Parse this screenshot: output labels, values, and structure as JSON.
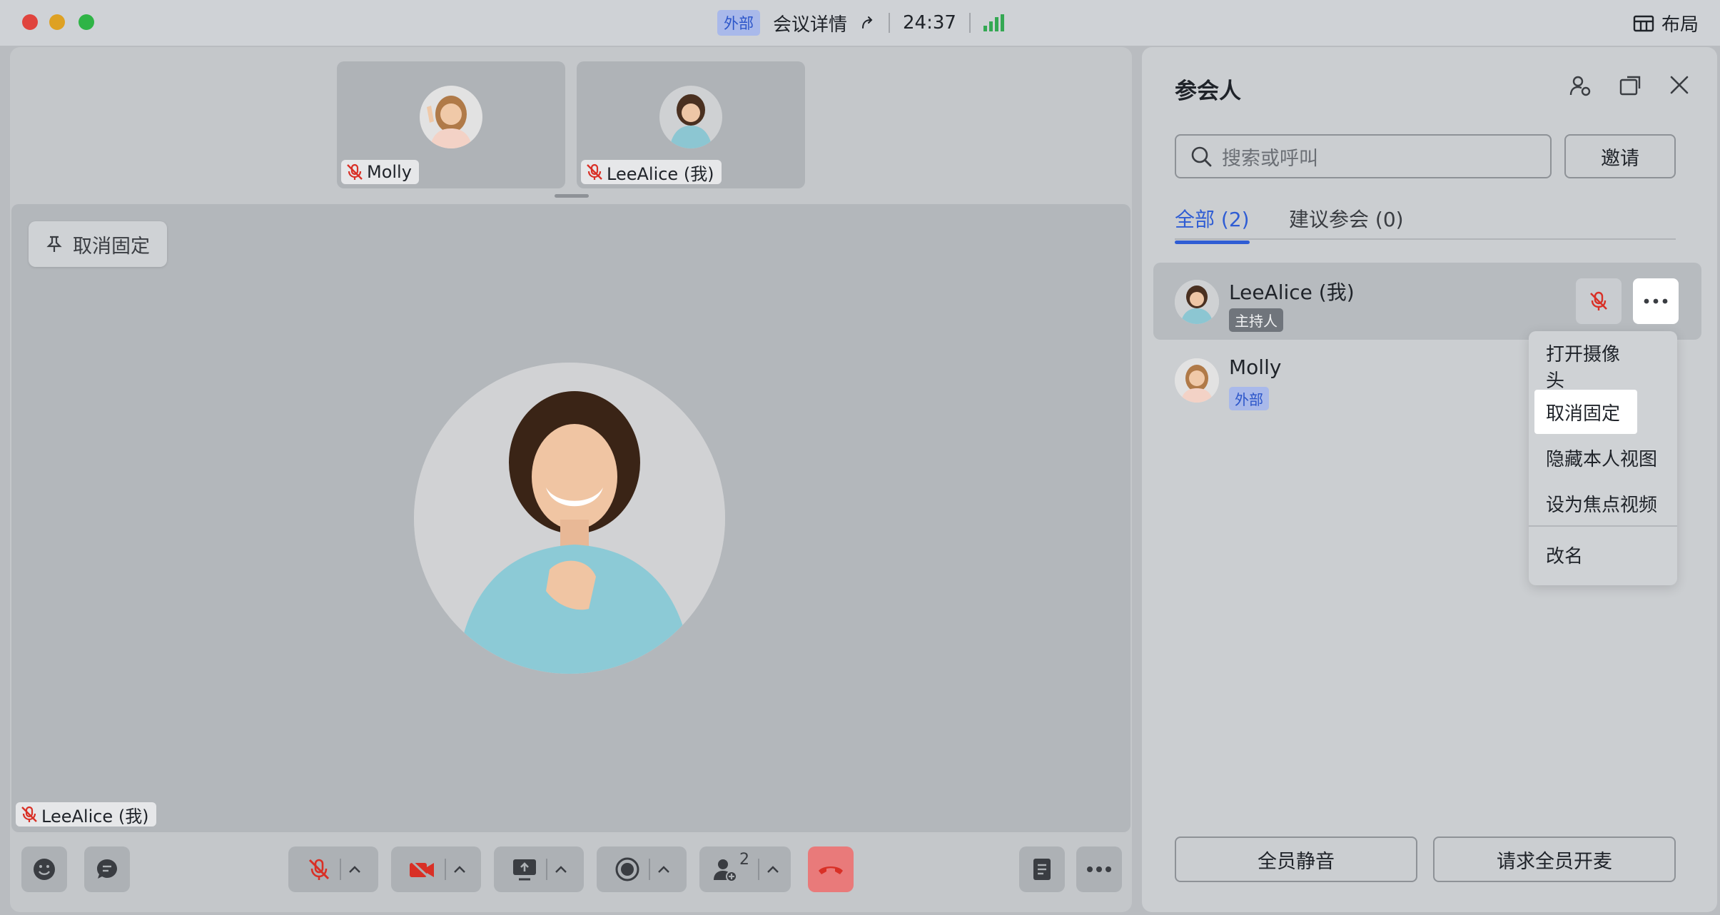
{
  "titlebar": {
    "external_badge": "外部",
    "meeting_details": "会议详情",
    "timer": "24:37",
    "layout_label": "布局",
    "signal_color": "#34a853"
  },
  "thumbnails": [
    {
      "name": "Molly"
    },
    {
      "name": "LeeAlice (我)"
    }
  ],
  "stage": {
    "unpin_label": "取消固定",
    "speaker_name": "LeeAlice (我)"
  },
  "toolbar": {
    "participants_count": "2",
    "hangup_color": "#e97a7a"
  },
  "panel": {
    "title": "参会人",
    "search_placeholder": "搜索或呼叫",
    "invite_label": "邀请",
    "tabs": [
      {
        "label": "全部 (2)"
      },
      {
        "label": "建议参会 (0)"
      }
    ],
    "participants": [
      {
        "name": "LeeAlice (我)",
        "badge": "主持人"
      },
      {
        "name": "Molly",
        "badge": "外部"
      }
    ],
    "menu": [
      {
        "label": "打开摄像头"
      },
      {
        "label": "取消固定"
      },
      {
        "label": "隐藏本人视图"
      },
      {
        "label": "设为焦点视频"
      },
      {
        "label": "改名"
      }
    ],
    "mute_all_label": "全员静音",
    "unmute_all_label": "请求全员开麦",
    "accent_color": "#2f5dd4"
  }
}
